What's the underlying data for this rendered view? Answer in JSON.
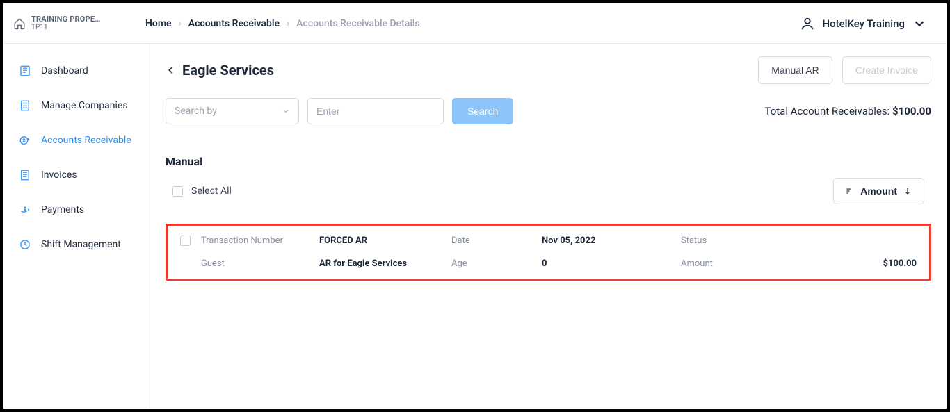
{
  "property": {
    "name": "TRAINING PROPE…",
    "code": "TP11"
  },
  "breadcrumbs": {
    "home": "Home",
    "ar": "Accounts Receivable",
    "details": "Accounts Receivable Details"
  },
  "user": {
    "display_name": "HotelKey Training"
  },
  "sidebar": {
    "items": [
      {
        "label": "Dashboard"
      },
      {
        "label": "Manage Companies"
      },
      {
        "label": "Accounts Receivable"
      },
      {
        "label": "Invoices"
      },
      {
        "label": "Payments"
      },
      {
        "label": "Shift Management"
      }
    ]
  },
  "page": {
    "title": "Eagle Services",
    "manual_ar_label": "Manual AR",
    "create_invoice_label": "Create Invoice",
    "search_by_placeholder": "Search by",
    "enter_placeholder": "Enter",
    "search_button": "Search",
    "total_label": "Total Account Receivables: ",
    "total_value": "$100.00",
    "section_title": "Manual",
    "select_all_label": "Select All",
    "sort_label": "Amount"
  },
  "transaction": {
    "tn_label": "Transaction Number",
    "tn_value": "FORCED AR",
    "date_label": "Date",
    "date_value": "Nov 05, 2022",
    "status_label": "Status",
    "status_value": "",
    "guest_label": "Guest",
    "guest_value": "AR for Eagle Services",
    "age_label": "Age",
    "age_value": "0",
    "amount_label": "Amount",
    "amount_value": "$100.00"
  }
}
